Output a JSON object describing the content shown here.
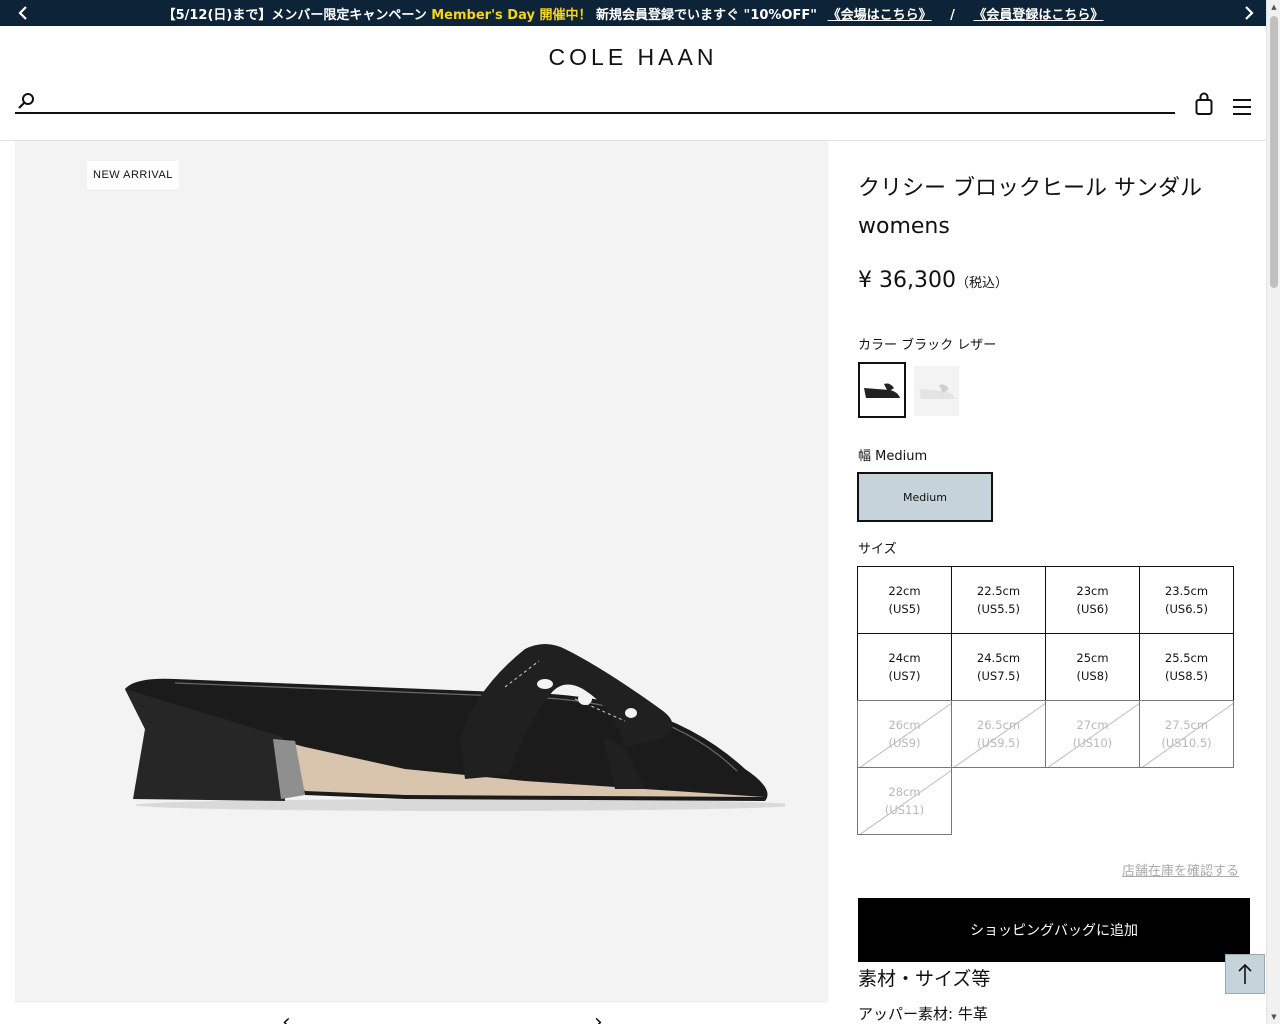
{
  "promo": {
    "text_main": "【5/12(日)まで】メンバー限定キャンペーン",
    "text_highlight": "Member's Day 開催中！",
    "text_after": "新規会員登録でいますぐ \"10%OFF\"",
    "link1": "《会場はこちら》",
    "separator": "/",
    "link2": "《会員登録はこちら》",
    "highlight_color": "#f6d31e",
    "bg_color": "#0d2338"
  },
  "header": {
    "logo": "COLE HAAN",
    "search_placeholder": "",
    "icons": [
      "search-icon",
      "bag-icon",
      "menu-icon"
    ]
  },
  "gallery": {
    "badge": "NEW ARRIVAL"
  },
  "product": {
    "title": "クリシー ブロックヒール サンダル",
    "subtitle": "womens",
    "price": "¥ 36,300",
    "tax_note": "（税込）",
    "color_label": "カラー ブラック レザー",
    "width_label": "幅 Medium",
    "width_option": "Medium",
    "size_label": "サイズ",
    "sizes": [
      {
        "cm": "22cm",
        "us": "(US5)",
        "available": true
      },
      {
        "cm": "22.5cm",
        "us": "(US5.5)",
        "available": true
      },
      {
        "cm": "23cm",
        "us": "(US6)",
        "available": true
      },
      {
        "cm": "23.5cm",
        "us": "(US6.5)",
        "available": true
      },
      {
        "cm": "24cm",
        "us": "(US7)",
        "available": true
      },
      {
        "cm": "24.5cm",
        "us": "(US7.5)",
        "available": true
      },
      {
        "cm": "25cm",
        "us": "(US8)",
        "available": true
      },
      {
        "cm": "25.5cm",
        "us": "(US8.5)",
        "available": true
      },
      {
        "cm": "26cm",
        "us": "(US9)",
        "available": false
      },
      {
        "cm": "26.5cm",
        "us": "(US9.5)",
        "available": false
      },
      {
        "cm": "27cm",
        "us": "(US10)",
        "available": false
      },
      {
        "cm": "27.5cm",
        "us": "(US10.5)",
        "available": false
      },
      {
        "cm": "28cm",
        "us": "(US11)",
        "available": false
      }
    ],
    "store_link": "店舗在庫を確認する",
    "add_to_bag": "ショッピングバッグに追加",
    "section_title": "素材・サイズ等",
    "material": "アッパー素材: 牛革"
  }
}
